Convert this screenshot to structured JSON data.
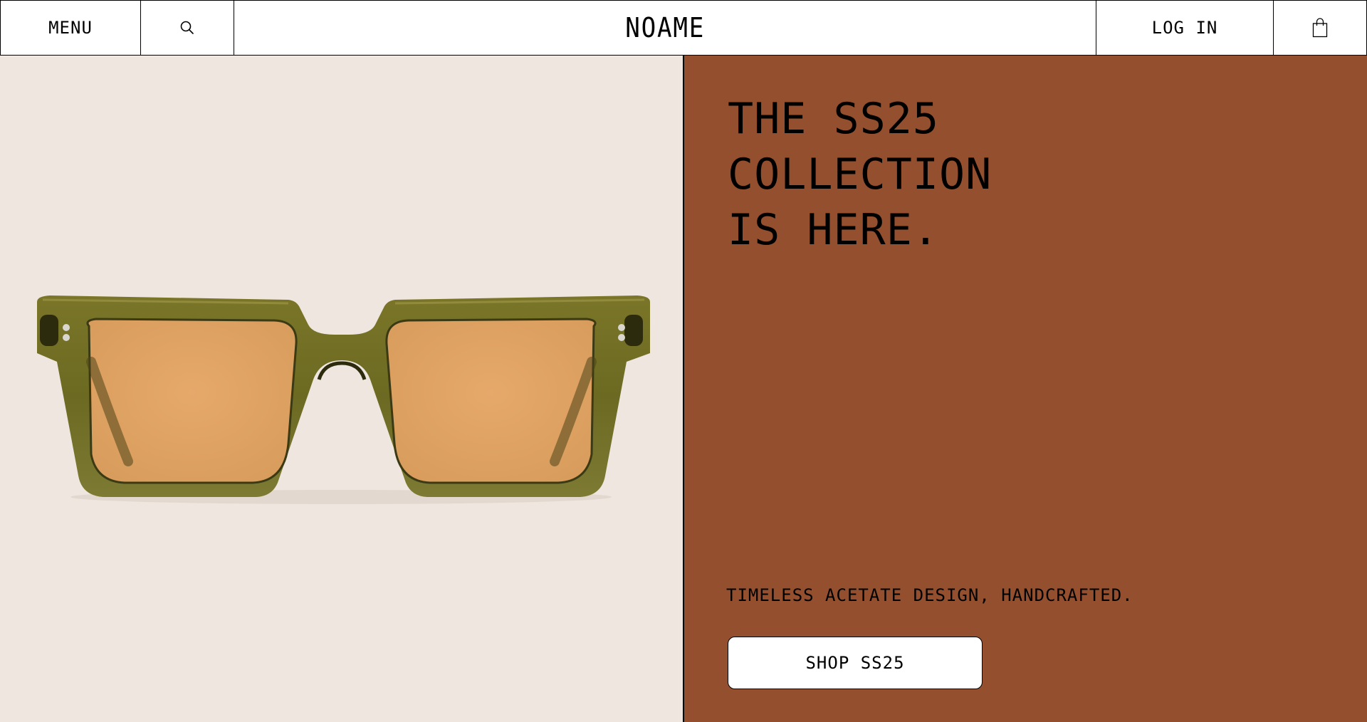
{
  "header": {
    "menu_label": "MENU",
    "search_icon": "search-icon",
    "logo": "NOAME",
    "login_label": "LOG IN",
    "cart_icon": "shopping-bag-icon"
  },
  "hero": {
    "headline_lines": [
      "THE SS25",
      "COLLECTION",
      "IS HERE."
    ],
    "tagline": "TIMELESS ACETATE DESIGN, HANDCRAFTED.",
    "cta_label": "SHOP SS25",
    "image": "olive-green-square-sunglasses-with-orange-lenses"
  },
  "colors": {
    "image_background": "#efe7df",
    "panel_background": "#934f2e",
    "frame": "#6e6a23",
    "lens": "#e0a466",
    "text": "#000000",
    "button_background": "#ffffff"
  }
}
